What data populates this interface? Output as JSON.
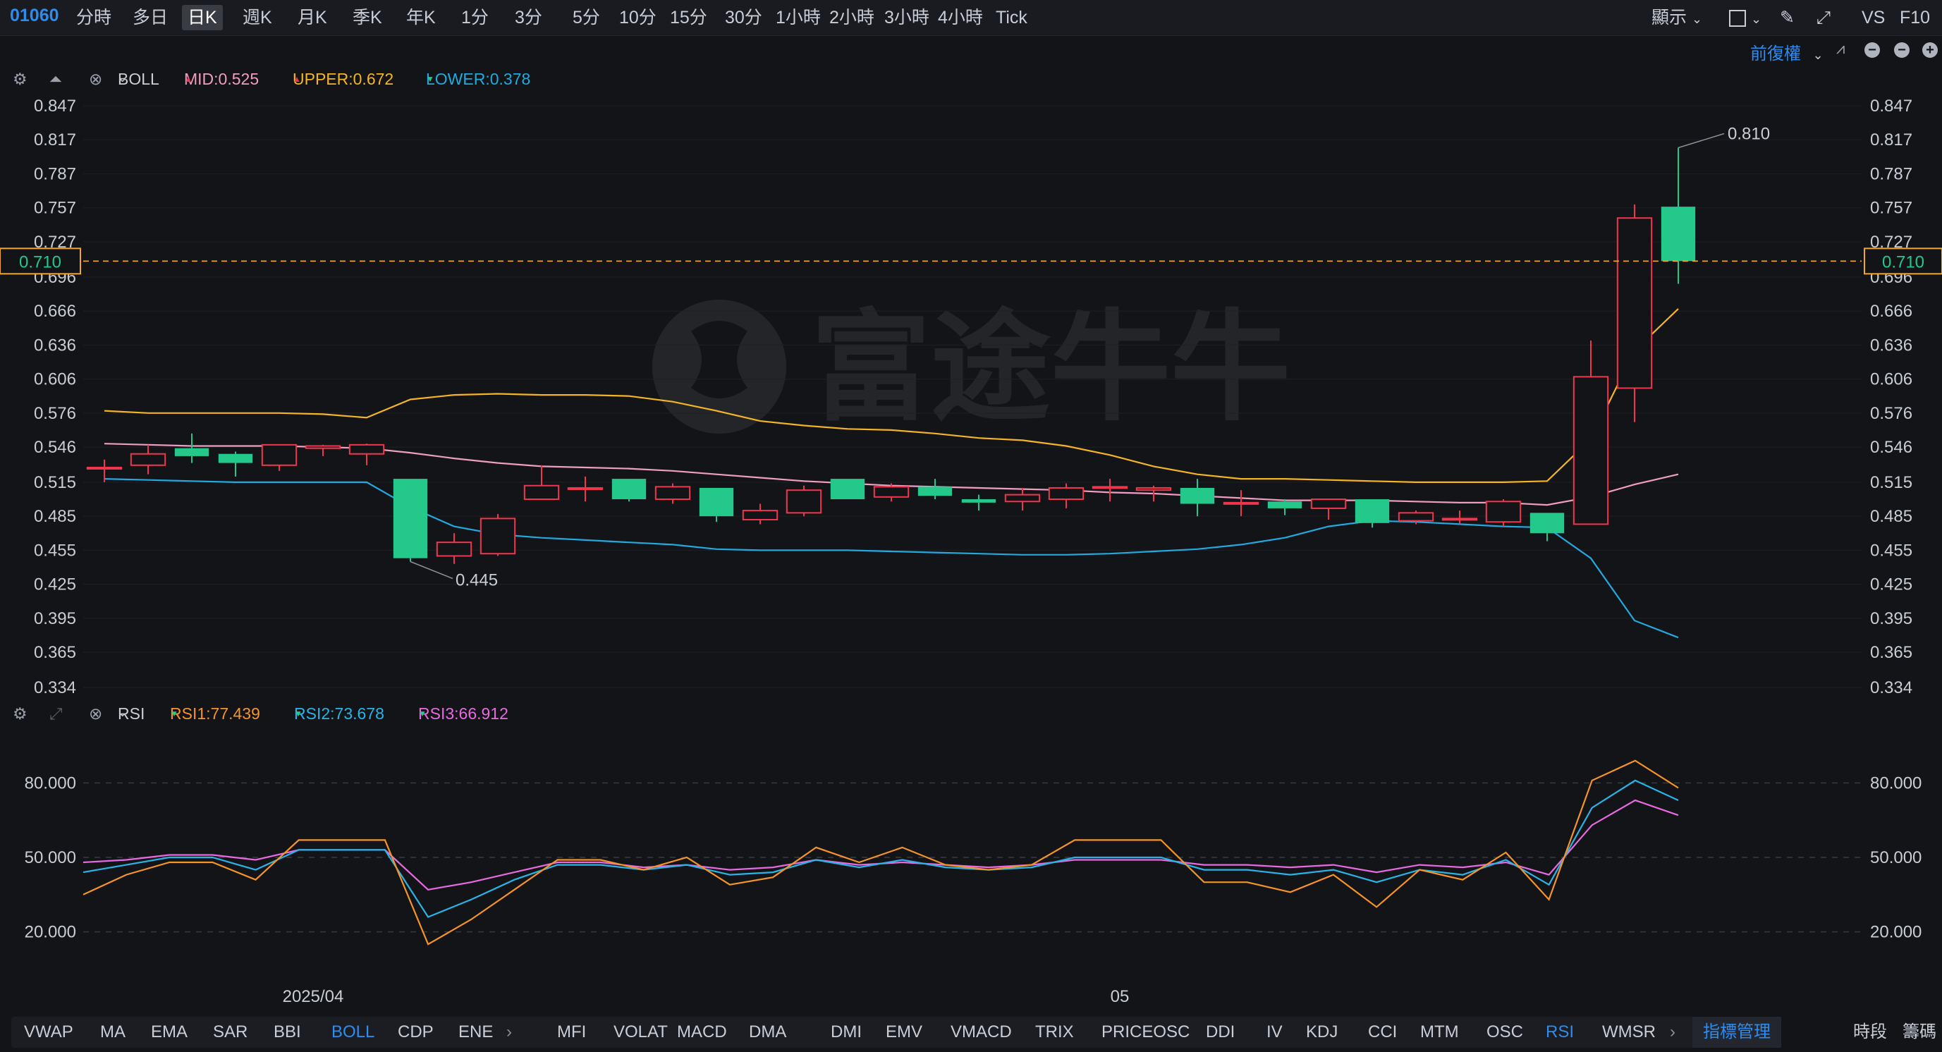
{
  "header": {
    "code": "01060",
    "timeframes": [
      "分時",
      "多日",
      "日K",
      "週K",
      "月K",
      "季K",
      "年K",
      "1分",
      "3分",
      "5分",
      "10分",
      "15分",
      "30分",
      "1小時",
      "2小時",
      "3小時",
      "4小時",
      "Tick"
    ],
    "active_timeframe": "日K",
    "display_label": "顯示",
    "vs_label": "VS",
    "f10_label": "F10",
    "adjust_label": "前復權"
  },
  "boll": {
    "name": "BOLL",
    "mid": "MID:0.525",
    "upper": "UPPER:0.672",
    "lower": "LOWER:0.378",
    "colors": {
      "mid": "#f09ec0",
      "upper": "#f5b523",
      "lower": "#22a9e0"
    }
  },
  "rsi": {
    "name": "RSI",
    "rsi1": "RSI1:77.439",
    "rsi2": "RSI2:73.678",
    "rsi3": "RSI3:66.912",
    "colors": {
      "rsi1": "#f5932a",
      "rsi2": "#29b3e6",
      "rsi3": "#e86ae0"
    }
  },
  "price_axis": [
    "0.847",
    "0.817",
    "0.787",
    "0.757",
    "0.727",
    "0.696",
    "0.666",
    "0.636",
    "0.606",
    "0.576",
    "0.546",
    "0.515",
    "0.485",
    "0.455",
    "0.425",
    "0.395",
    "0.365",
    "0.334"
  ],
  "rsi_axis": [
    "80.000",
    "50.000",
    "20.000"
  ],
  "current_price": "0.710",
  "annotations": {
    "high": "0.810",
    "low": "0.445"
  },
  "date_labels": {
    "month1": "2025/04",
    "month2": "05"
  },
  "watermark": "富途牛牛",
  "colors": {
    "up": "#f0364d",
    "down": "#24c88a",
    "accent": "#2d8cf0",
    "price_line": "#f5a623"
  },
  "chart_data": {
    "type": "candlestick",
    "candles": [
      {
        "o": 0.528,
        "h": 0.535,
        "l": 0.515,
        "c": 0.528
      },
      {
        "o": 0.53,
        "h": 0.548,
        "l": 0.522,
        "c": 0.54
      },
      {
        "o": 0.545,
        "h": 0.558,
        "l": 0.532,
        "c": 0.538
      },
      {
        "o": 0.54,
        "h": 0.542,
        "l": 0.52,
        "c": 0.532
      },
      {
        "o": 0.53,
        "h": 0.548,
        "l": 0.525,
        "c": 0.548
      },
      {
        "o": 0.545,
        "h": 0.548,
        "l": 0.538,
        "c": 0.547
      },
      {
        "o": 0.54,
        "h": 0.549,
        "l": 0.53,
        "c": 0.548
      },
      {
        "o": 0.518,
        "h": 0.518,
        "l": 0.445,
        "c": 0.448
      },
      {
        "o": 0.45,
        "h": 0.47,
        "l": 0.443,
        "c": 0.462
      },
      {
        "o": 0.452,
        "h": 0.487,
        "l": 0.45,
        "c": 0.483
      },
      {
        "o": 0.5,
        "h": 0.53,
        "l": 0.5,
        "c": 0.512
      },
      {
        "o": 0.51,
        "h": 0.52,
        "l": 0.498,
        "c": 0.51
      },
      {
        "o": 0.518,
        "h": 0.518,
        "l": 0.498,
        "c": 0.5
      },
      {
        "o": 0.5,
        "h": 0.514,
        "l": 0.496,
        "c": 0.511
      },
      {
        "o": 0.51,
        "h": 0.51,
        "l": 0.48,
        "c": 0.485
      },
      {
        "o": 0.482,
        "h": 0.496,
        "l": 0.478,
        "c": 0.49
      },
      {
        "o": 0.488,
        "h": 0.512,
        "l": 0.485,
        "c": 0.508
      },
      {
        "o": 0.518,
        "h": 0.518,
        "l": 0.5,
        "c": 0.5
      },
      {
        "o": 0.502,
        "h": 0.514,
        "l": 0.498,
        "c": 0.511
      },
      {
        "o": 0.511,
        "h": 0.518,
        "l": 0.5,
        "c": 0.503
      },
      {
        "o": 0.5,
        "h": 0.504,
        "l": 0.49,
        "c": 0.497
      },
      {
        "o": 0.498,
        "h": 0.51,
        "l": 0.49,
        "c": 0.504
      },
      {
        "o": 0.5,
        "h": 0.514,
        "l": 0.492,
        "c": 0.51
      },
      {
        "o": 0.51,
        "h": 0.518,
        "l": 0.498,
        "c": 0.511
      },
      {
        "o": 0.508,
        "h": 0.512,
        "l": 0.498,
        "c": 0.51
      },
      {
        "o": 0.51,
        "h": 0.518,
        "l": 0.485,
        "c": 0.496
      },
      {
        "o": 0.497,
        "h": 0.508,
        "l": 0.485,
        "c": 0.497
      },
      {
        "o": 0.498,
        "h": 0.5,
        "l": 0.486,
        "c": 0.492
      },
      {
        "o": 0.492,
        "h": 0.5,
        "l": 0.482,
        "c": 0.5
      },
      {
        "o": 0.5,
        "h": 0.5,
        "l": 0.475,
        "c": 0.479
      },
      {
        "o": 0.481,
        "h": 0.49,
        "l": 0.478,
        "c": 0.488
      },
      {
        "o": 0.483,
        "h": 0.49,
        "l": 0.478,
        "c": 0.483
      },
      {
        "o": 0.48,
        "h": 0.5,
        "l": 0.476,
        "c": 0.498
      },
      {
        "o": 0.488,
        "h": 0.488,
        "l": 0.463,
        "c": 0.47
      },
      {
        "o": 0.478,
        "h": 0.64,
        "l": 0.478,
        "c": 0.608
      },
      {
        "o": 0.598,
        "h": 0.76,
        "l": 0.568,
        "c": 0.748
      },
      {
        "o": 0.758,
        "h": 0.81,
        "l": 0.69,
        "c": 0.71
      }
    ],
    "boll_mid": [
      0.549,
      0.548,
      0.547,
      0.547,
      0.547,
      0.546,
      0.545,
      0.541,
      0.536,
      0.532,
      0.529,
      0.528,
      0.527,
      0.525,
      0.522,
      0.519,
      0.516,
      0.514,
      0.512,
      0.511,
      0.51,
      0.509,
      0.508,
      0.506,
      0.505,
      0.503,
      0.501,
      0.499,
      0.499,
      0.499,
      0.498,
      0.497,
      0.497,
      0.495,
      0.502,
      0.513,
      0.522
    ],
    "boll_upper": [
      0.578,
      0.576,
      0.576,
      0.576,
      0.576,
      0.575,
      0.572,
      0.588,
      0.592,
      0.593,
      0.592,
      0.592,
      0.591,
      0.586,
      0.578,
      0.569,
      0.565,
      0.562,
      0.561,
      0.558,
      0.554,
      0.552,
      0.547,
      0.539,
      0.529,
      0.522,
      0.518,
      0.518,
      0.517,
      0.516,
      0.515,
      0.515,
      0.515,
      0.516,
      0.553,
      0.631,
      0.668
    ],
    "boll_lower": [
      0.518,
      0.517,
      0.516,
      0.515,
      0.515,
      0.515,
      0.515,
      0.493,
      0.476,
      0.469,
      0.466,
      0.464,
      0.462,
      0.46,
      0.456,
      0.455,
      0.455,
      0.455,
      0.454,
      0.453,
      0.452,
      0.451,
      0.451,
      0.452,
      0.454,
      0.456,
      0.46,
      0.466,
      0.476,
      0.481,
      0.48,
      0.478,
      0.476,
      0.475,
      0.448,
      0.393,
      0.378
    ],
    "rsi1": [
      35,
      43,
      48,
      48,
      41,
      57,
      57,
      57,
      15,
      25,
      37,
      49,
      49,
      45,
      50,
      39,
      42,
      54,
      48,
      54,
      47,
      45,
      47,
      57,
      57,
      57,
      40,
      40,
      36,
      43,
      30,
      45,
      41,
      52,
      33,
      81,
      89,
      78
    ],
    "rsi2": [
      44,
      47,
      50,
      50,
      45,
      53,
      53,
      53,
      26,
      33,
      41,
      47,
      47,
      45,
      47,
      43,
      44,
      49,
      46,
      49,
      46,
      45,
      46,
      50,
      50,
      50,
      45,
      45,
      43,
      45,
      40,
      45,
      43,
      49,
      39,
      70,
      81,
      73
    ],
    "rsi3": [
      48,
      49,
      51,
      51,
      49,
      53,
      53,
      53,
      37,
      40,
      44,
      48,
      48,
      46,
      47,
      45,
      46,
      49,
      47,
      48,
      47,
      46,
      47,
      49,
      49,
      49,
      47,
      47,
      46,
      47,
      44,
      47,
      46,
      48,
      43,
      63,
      73,
      67
    ],
    "ylim": [
      0.334,
      0.847
    ],
    "rsi_ylim": [
      0,
      100
    ]
  },
  "bottom": {
    "indicators_main": [
      "VWAP",
      "MA",
      "EMA",
      "SAR",
      "BBI",
      "BOLL",
      "CDP",
      "ENE"
    ],
    "active_main": "BOLL",
    "indicators_sub": [
      "MFI",
      "VOLAT",
      "MACD",
      "DMA",
      "DMI",
      "EMV",
      "VMACD",
      "TRIX",
      "PRICEOSC",
      "DDI",
      "IV",
      "KDJ",
      "CCI",
      "MTM",
      "OSC",
      "RSI",
      "WMSR"
    ],
    "active_sub": "RSI",
    "manage_label": "指標管理",
    "time_period_label": "時段",
    "chips_label": "籌碼"
  }
}
